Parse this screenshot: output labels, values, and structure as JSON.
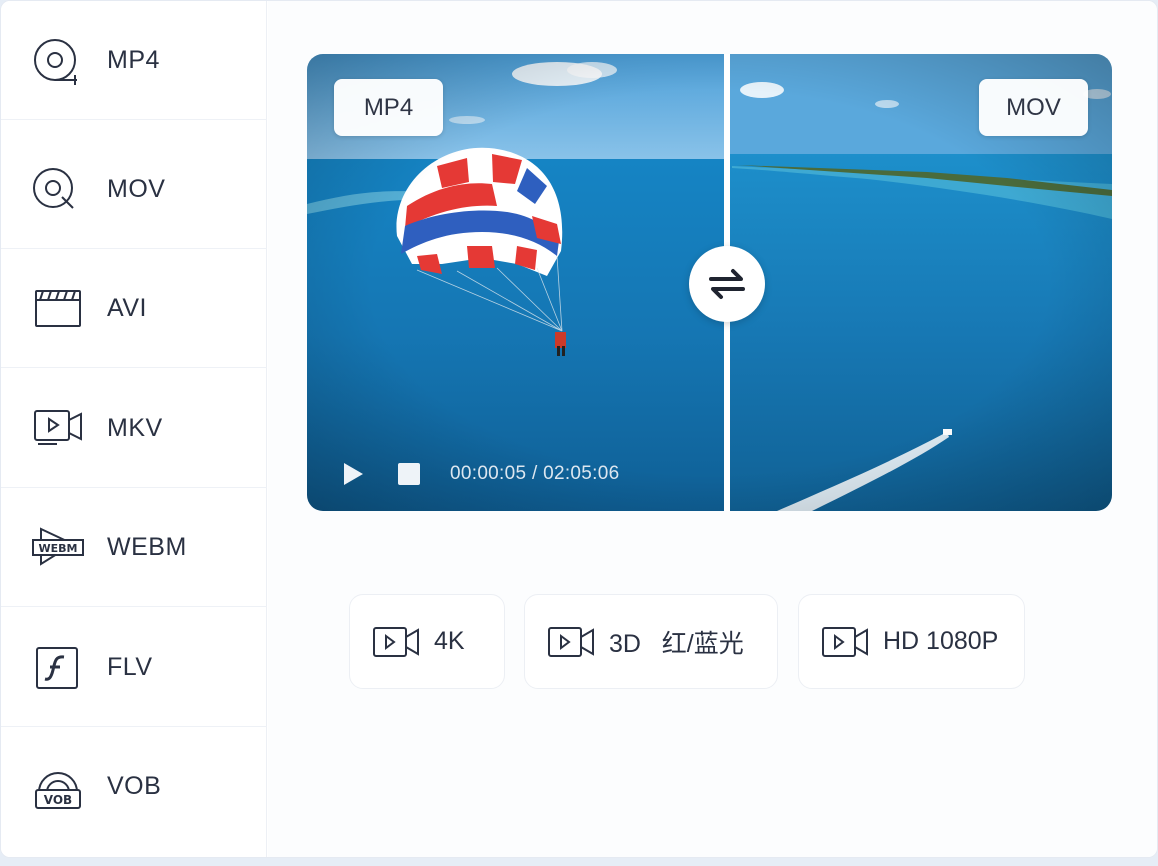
{
  "sidebar": {
    "items": [
      {
        "label": "MP4",
        "icon": "disc-icon"
      },
      {
        "label": "MOV",
        "icon": "disc-search-icon"
      },
      {
        "label": "AVI",
        "icon": "clapperboard-icon"
      },
      {
        "label": "MKV",
        "icon": "video-monitor-icon"
      },
      {
        "label": "WEBM",
        "icon": "webm-icon"
      },
      {
        "label": "FLV",
        "icon": "flash-icon"
      },
      {
        "label": "VOB",
        "icon": "vob-icon"
      }
    ]
  },
  "preview": {
    "left_tag": "MP4",
    "right_tag": "MOV",
    "timecode": "00:00:05 / 02:05:06",
    "swap_icon": "swap-arrows-icon"
  },
  "options": [
    {
      "label": "4K",
      "icon": "video-camera-icon"
    },
    {
      "label": "3D   红/蓝光",
      "icon": "video-camera-icon"
    },
    {
      "label": "HD 1080P",
      "icon": "video-camera-icon"
    }
  ],
  "colors": {
    "sea": "#1f7fb7",
    "sky": "#5ba8db",
    "text": "#2a3142",
    "accent_red": "#e33a3a",
    "accent_blue": "#2f5fbf"
  }
}
